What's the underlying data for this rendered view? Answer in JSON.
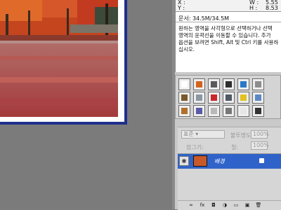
{
  "info": {
    "x_label": "X :",
    "y_label": "Y :",
    "w_label": "W :",
    "h_label": "H :",
    "w_value": "5.55",
    "h_value": "8.53",
    "doc_size": "문서: 34.5M/34.5M",
    "help_text": "원하는 영역을 사각형으로 선택하거나 선택\n영역의 윤곽선을 이동할 수 있습니다. 추가\n옵션을 보려면 Shift, Alt 및 Ctrl 키를 사용하\n십시오."
  },
  "styles": {
    "swatches": [
      {
        "icon": "no-style-icon",
        "color": "#ffffff"
      },
      {
        "icon": "orange-glow-icon",
        "color": "#d4621c"
      },
      {
        "icon": "gray-bevel-icon",
        "color": "#5a5a5a"
      },
      {
        "icon": "dark-bevel-icon",
        "color": "#2e2e2e"
      },
      {
        "icon": "blue-gel-icon",
        "color": "#2a78c9"
      },
      {
        "icon": "gray-gradient-icon",
        "color": "#8d8d8d"
      },
      {
        "icon": "brown-wood-icon",
        "color": "#7a5a2a"
      },
      {
        "icon": "steel-icon",
        "color": "#8b97a3"
      },
      {
        "icon": "red-gel-icon",
        "color": "#c9272c"
      },
      {
        "icon": "chrome-icon",
        "color": "#4f5a66"
      },
      {
        "icon": "yellow-gel-icon",
        "color": "#e2c220"
      },
      {
        "icon": "blue-glass-icon",
        "color": "#5a88c2"
      },
      {
        "icon": "bronze-icon",
        "color": "#b0702a"
      },
      {
        "icon": "purple-glass-icon",
        "color": "#5a5aa8"
      },
      {
        "icon": "silver-icon",
        "color": "#b9b9b9"
      },
      {
        "icon": "pattern-icon",
        "color": "#777777"
      },
      {
        "icon": "light-icon",
        "color": "#e6e6e6"
      },
      {
        "icon": "black-icon",
        "color": "#333333"
      }
    ]
  },
  "layers": {
    "blend_mode": "표준",
    "opacity_label": "불투명도:",
    "opacity_value": "100%",
    "lock_label": "잠그기:",
    "fill_label": "칠:",
    "fill_value": "100%",
    "layer_name": "배경",
    "bottom_icons": [
      "link-icon",
      "fx-icon",
      "mask-icon",
      "adjustment-icon",
      "folder-icon",
      "new-layer-icon",
      "trash-icon"
    ],
    "bottom_glyphs": [
      "∞",
      "fx",
      "◘",
      "◑",
      "▭",
      "▣",
      "🗑"
    ]
  }
}
